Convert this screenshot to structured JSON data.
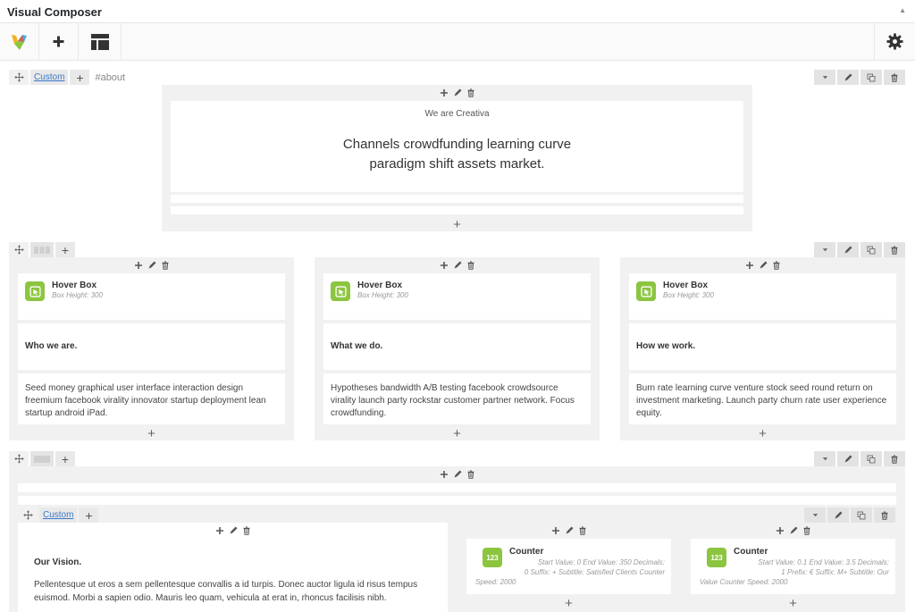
{
  "window": {
    "title": "Visual Composer",
    "collapse_icon": "triangle-up"
  },
  "toolbar": {
    "logo_icon": "visual-composer-logo",
    "add_icon": "plus",
    "templates_icon": "template-layout",
    "settings_icon": "gear"
  },
  "row1": {
    "label": "Custom",
    "anchor": "#about",
    "pre_heading": "We are Creativa",
    "main_heading_line1": "Channels crowdfunding learning curve",
    "main_heading_line2": "paradigm shift assets market."
  },
  "row2": {
    "columns": [
      {
        "element": "Hover Box",
        "param": "Box Height: 300",
        "heading": "Who we are.",
        "text_lines": [
          "Seed money graphical user interface interaction design",
          "freemium facebook virality innovator startup deployment lean",
          "startup android iPad."
        ]
      },
      {
        "element": "Hover Box",
        "param": "Box Height: 300",
        "heading": "What we do.",
        "text_lines": [
          "Hypotheses bandwidth A/B testing facebook crowdsource",
          "virality launch party rockstar customer partner network. Focus",
          "crowdfunding."
        ]
      },
      {
        "element": "Hover Box",
        "param": "Box Height: 300",
        "heading": "How we work.",
        "text_lines": [
          "Burn rate learning curve venture stock seed round return on",
          "investment marketing. Launch party churn rate user experience",
          "equity."
        ]
      }
    ]
  },
  "row3": {
    "inner_label": "Custom",
    "vision_heading": "Our Vision.",
    "vision_lines": [
      "Pellentesque ut eros a sem pellentesque convallis a id turpis. Donec auctor ligula id risus tempus",
      "euismod. Morbi a sapien odio. Mauris leo quam, vehicula at erat in, rhoncus facilisis nibh."
    ],
    "counters": [
      {
        "icon_text": "123",
        "name": "Counter",
        "params_lines": [
          "Start Value: 0  End Value: 350  Decimals:",
          "0  Suffix: +  Subtitle: Satisfied Clients  Counter",
          "Speed: 2000"
        ]
      },
      {
        "icon_text": "123",
        "name": "Counter",
        "params_lines": [
          "Start Value: 0.1  End Value: 3.5  Decimals:",
          "1  Prefix: €  Suffix: M+  Subtitle: Our",
          "Value  Counter Speed: 2000"
        ]
      }
    ]
  },
  "colors": {
    "accent_green": "#8cc540",
    "link_blue": "#3c78c6",
    "column_bg": "#f1f1f1"
  }
}
